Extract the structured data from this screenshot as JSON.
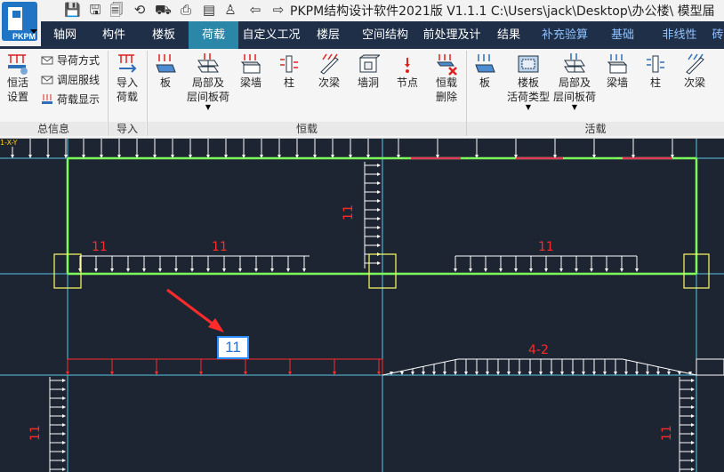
{
  "title_bar": {
    "title": "PKPM结构设计软件2021版 V1.1.1 C:\\Users\\jack\\Desktop\\办公楼\\ 模型届",
    "logo_text": "PKPM",
    "quick_icons": [
      "save-icon",
      "save-as-icon",
      "save-all-icon",
      "history-icon",
      "bus-icon",
      "print-icon",
      "document-icon",
      "user-icon",
      "back-arrow-icon",
      "forward-arrow-icon"
    ]
  },
  "menu": {
    "tabs": [
      {
        "label": "轴网"
      },
      {
        "label": "构件"
      },
      {
        "label": "楼板"
      },
      {
        "label": "荷载"
      },
      {
        "label": "自定义工况"
      },
      {
        "label": "楼层"
      },
      {
        "label": "空间结构"
      },
      {
        "label": "前处理及计"
      },
      {
        "label": "结果"
      },
      {
        "label": "补充验算"
      },
      {
        "label": "基础"
      },
      {
        "label": "非线性"
      },
      {
        "label": "砖"
      }
    ],
    "active": "荷载"
  },
  "ribbon": {
    "general": {
      "main_button": "恒活\n设置",
      "small_buttons": [
        "导荷方式",
        "调屈服线",
        "荷载显示"
      ],
      "group_label": "总信息"
    },
    "import": {
      "button": "导入\n荷载",
      "group_label": "导入"
    },
    "dead": {
      "buttons": [
        "板",
        "局部及\n层间板荷",
        "梁墙",
        "柱",
        "次梁",
        "墙洞",
        "节点",
        "恒载\n删除"
      ],
      "group_label": "恒载"
    },
    "live": {
      "buttons": [
        "板",
        "楼板\n活荷类型",
        "局部及\n层间板荷",
        "梁墙",
        "柱",
        "次梁"
      ],
      "group_label": "活载"
    }
  },
  "canvas": {
    "axis_label": "1-X-Y",
    "load_labels": [
      "11",
      "11",
      "11",
      "11",
      "4-2",
      "11",
      "11",
      "11"
    ],
    "selected_load_label": "11",
    "colors": {
      "background": "#1e2532",
      "load": "#ff2a2a",
      "arrow": "#ffffff",
      "beam": "#7cff5a",
      "grid": "#5ac8e6",
      "column": "#ffff66",
      "callout_border": "#2b8cff"
    }
  }
}
